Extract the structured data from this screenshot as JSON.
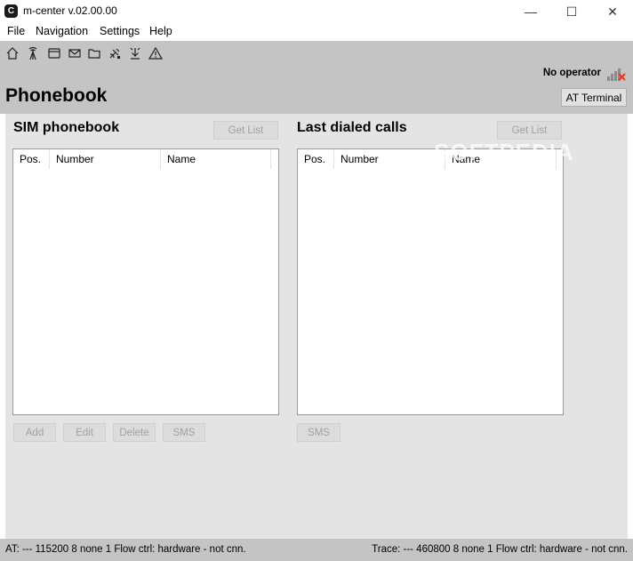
{
  "window": {
    "app_icon_letter": "C",
    "title": "m-center v.02.00.00",
    "minimize": "—",
    "maximize": "☐",
    "close": "✕"
  },
  "menu": [
    "File",
    "Navigation",
    "Settings",
    "Help"
  ],
  "toolbar": {
    "icons": [
      "home-icon",
      "antenna-icon",
      "window-icon",
      "mail-icon",
      "folder-icon",
      "satellite-icon",
      "download-icon",
      "warning-icon"
    ]
  },
  "operator": {
    "text": "No operator",
    "signal_icon": "signal-no-service-icon"
  },
  "page": {
    "title": "Phonebook",
    "at_terminal": "AT Terminal"
  },
  "sim": {
    "title": "SIM phonebook",
    "get_list": "Get List",
    "columns": [
      "Pos.",
      "Number",
      "Name"
    ],
    "rows": [],
    "buttons": [
      "Add",
      "Edit",
      "Delete",
      "SMS"
    ]
  },
  "last_dialed": {
    "title": "Last dialed calls",
    "get_list": "Get List",
    "columns": [
      "Pos.",
      "Number",
      "Name"
    ],
    "rows": [],
    "buttons": [
      "SMS"
    ]
  },
  "watermark": "SOFTPEDIA",
  "status": {
    "left": "AT: --- 115200 8 none 1 Flow ctrl: hardware - not cnn.",
    "right": "Trace: --- 460800 8 none 1 Flow ctrl: hardware - not cnn."
  },
  "colors": {
    "chrome_gray": "#c4c4c4",
    "panel_gray": "#e4e4e4",
    "signal_red": "#e83a2e"
  }
}
